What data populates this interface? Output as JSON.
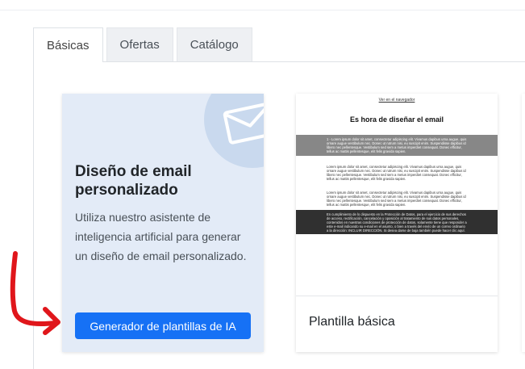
{
  "tabs": [
    {
      "label": "Básicas",
      "active": true
    },
    {
      "label": "Ofertas",
      "active": false
    },
    {
      "label": "Catálogo",
      "active": false
    }
  ],
  "ai_card": {
    "icon": "envelope-icon",
    "title": "Diseño de email personalizado",
    "description": "Utiliza nuestro asistente de inteligencia artificial para generar un diseño de email personalizado.",
    "button_label": "Generador de plantillas de IA",
    "button_color": "#1671f5",
    "background": "#e3ebf7"
  },
  "template_card": {
    "name": "Plantilla básica",
    "preview": {
      "browser_link": "Ver en el navegador",
      "heading": "Es hora de diseñar el email",
      "gray_block": "1 - Lorem ipsum dolor sit amet, consectetur adipiscing elit. Vivamus dapibus urna augue, quis ornare augue vestibulum nec. Donec ut rutrum nisi, eu suscipit enim. Suspendisse dapibus id libero nec pellentesque. Vestibulum sed sem a metus imperdiet consequat. Donec efficitur, tellus ac mattis pellentesque, elit felis gravida sapien.",
      "paragraph_1": "Lorem ipsum dolor sit amet, consectetur adipiscing elit. Vivamus dapibus urna augue, quis ornare augue vestibulum nec. Donec ut rutrum nisi, eu suscipit enim. Suspendisse dapibus id libero nec pellentesque. Vestibulum sed sem a metus imperdiet consequat. Donec efficitur, tellus ac mattis pellentesque, elit felis gravida sapien.",
      "paragraph_2": "Lorem ipsum dolor sit amet, consectetur adipiscing elit. Vivamus dapibus urna augue, quis ornare augue vestibulum nec. Donec ut rutrum nisi, eu suscipit enim. Suspendisse dapibus id libero nec pellentesque. Vestibulum sed sem a metus imperdiet consequat. Donec efficitur, tellus ac mattis pellentesque, elit felis gravida sapien.",
      "footer_block": "En cumplimiento de lo dispuesto en la Protección de Datos, para el ejercicio de sus derechos de acceso, rectificación, cancelación y oposición al tratamiento de sus datos personales, contenidos en nuestras condiciones de protección de datos, solamente tiene que responder a este e-mail indicando su e-mail en el asunto, o bien a través del envío de un correo ordinario a la dirección: INCLUIR DIRECCIÓN. Si desea darse de baja también puede hacer clic aquí."
    }
  },
  "annotation": {
    "color": "#e0161b",
    "icon": "red-arrow-annotation"
  }
}
